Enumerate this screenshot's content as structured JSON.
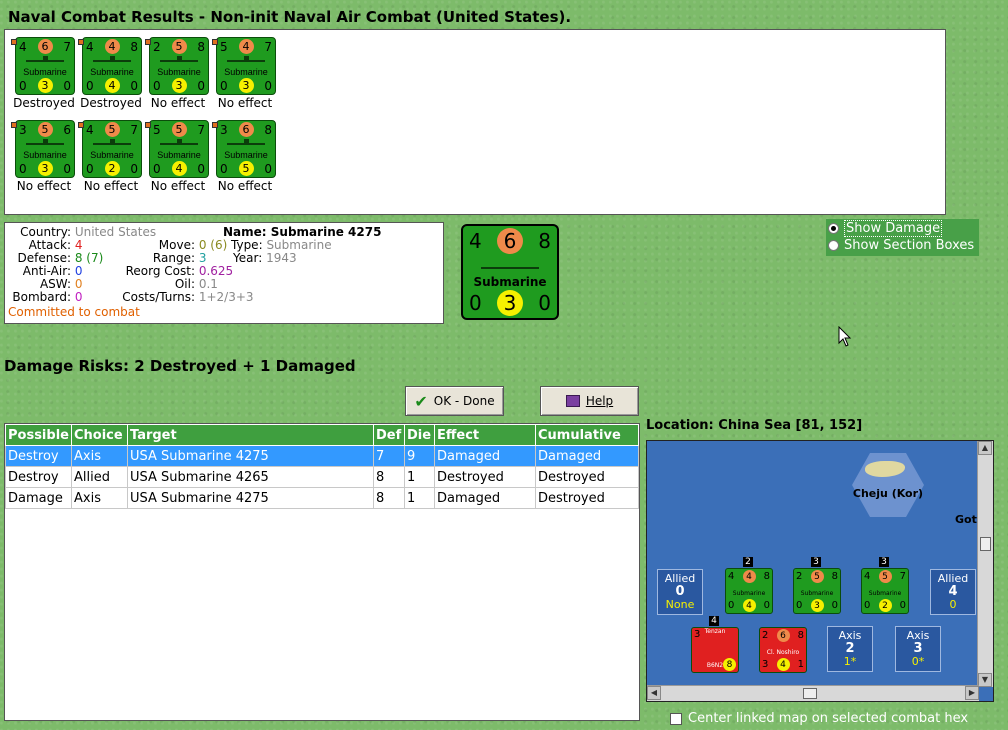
{
  "title": "Naval Combat Results - Non-init Naval Air Combat (United States).",
  "results": [
    {
      "top": [
        "4",
        "6",
        "7"
      ],
      "name": "Submarine",
      "bottom": [
        "0",
        "3",
        "0"
      ],
      "label": "Destroyed"
    },
    {
      "top": [
        "4",
        "4",
        "8"
      ],
      "name": "Submarine",
      "bottom": [
        "0",
        "4",
        "0"
      ],
      "label": "Destroyed"
    },
    {
      "top": [
        "2",
        "5",
        "8"
      ],
      "name": "Submarine",
      "bottom": [
        "0",
        "3",
        "0"
      ],
      "label": "No effect"
    },
    {
      "top": [
        "5",
        "4",
        "7"
      ],
      "name": "Submarine",
      "bottom": [
        "0",
        "3",
        "0"
      ],
      "label": "No effect"
    },
    {
      "top": [
        "3",
        "5",
        "6"
      ],
      "name": "Submarine",
      "bottom": [
        "0",
        "3",
        "0"
      ],
      "label": "No effect"
    },
    {
      "top": [
        "4",
        "5",
        "7"
      ],
      "name": "Submarine",
      "bottom": [
        "0",
        "2",
        "0"
      ],
      "label": "No effect"
    },
    {
      "top": [
        "5",
        "5",
        "7"
      ],
      "name": "Submarine",
      "bottom": [
        "0",
        "4",
        "0"
      ],
      "label": "No effect"
    },
    {
      "top": [
        "3",
        "6",
        "8"
      ],
      "name": "Submarine",
      "bottom": [
        "0",
        "5",
        "0"
      ],
      "label": "No effect"
    }
  ],
  "info": {
    "country_label": "Country:",
    "country": "United States",
    "attack_label": "Attack:",
    "attack": "4",
    "defense_label": "Defense:",
    "defense": "8 (7)",
    "antiair_label": "Anti-Air:",
    "antiair": "0",
    "asw_label": "ASW:",
    "asw": "0",
    "bombard_label": "Bombard:",
    "bombard": "0",
    "name_label": "Name:",
    "name": "Submarine 4275",
    "move_label": "Move:",
    "move": "0 (6)",
    "type_label": "Type:",
    "type": "Submarine",
    "range_label": "Range:",
    "range": "3",
    "year_label": "Year:",
    "year": "1943",
    "reorg_label": "Reorg Cost:",
    "reorg": "0.625",
    "oil_label": "Oil:",
    "oil": "0.1",
    "costs_label": "Costs/Turns:",
    "costs": "1+2/3+3",
    "status": "Committed to combat"
  },
  "big_counter": {
    "top": [
      "4",
      "6",
      "8"
    ],
    "name": "Submarine",
    "bottom": [
      "0",
      "3",
      "0"
    ]
  },
  "options": {
    "show_damage": "Show Damage",
    "show_sections": "Show Section Boxes"
  },
  "risks": "Damage Risks:  2 Destroyed + 1 Damaged",
  "buttons": {
    "ok": "OK - Done",
    "help": "Help"
  },
  "table": {
    "headers": [
      "Possible",
      "Choice",
      "Target",
      "Def",
      "Die",
      "Effect",
      "Cumulative"
    ],
    "rows": [
      [
        "Destroy",
        "Axis",
        "USA Submarine 4275",
        "7",
        "9",
        "Damaged",
        "Damaged"
      ],
      [
        "Destroy",
        "Allied",
        "USA Submarine 4265",
        "8",
        "1",
        "Destroyed",
        "Destroyed"
      ],
      [
        "Damage",
        "Axis",
        "USA Submarine 4275",
        "8",
        "1",
        "Damaged",
        "Destroyed"
      ]
    ]
  },
  "location": "Location:  China Sea [81, 152]",
  "map": {
    "island": "Cheju (Kor)",
    "got": "Got",
    "allied_box": {
      "label": "Allied",
      "num": "0",
      "sub": "None"
    },
    "allied_box2": {
      "label": "Allied",
      "num": "4",
      "sub": "0"
    },
    "axis_box1": {
      "label": "Axis",
      "num": "2",
      "sub": "1*"
    },
    "axis_box2": {
      "label": "Axis",
      "num": "3",
      "sub": "0*"
    },
    "stacks": [
      {
        "badge": "2",
        "top": [
          "4",
          "4",
          "8"
        ],
        "name": "Submarine",
        "bottom": [
          "0",
          "4",
          "0"
        ]
      },
      {
        "badge": "3",
        "top": [
          "2",
          "5",
          "8"
        ],
        "name": "Submarine",
        "bottom": [
          "0",
          "3",
          "0"
        ]
      },
      {
        "badge": "3",
        "top": [
          "4",
          "5",
          "7"
        ],
        "name": "Submarine",
        "bottom": [
          "0",
          "2",
          "0"
        ]
      }
    ],
    "red_stacks": [
      {
        "badge": "4",
        "top": [
          "3",
          "",
          ""
        ],
        "name": "Tenzan",
        "bottom": [
          "",
          "",
          "8"
        ],
        "extra": "B6N2"
      },
      {
        "badge": "",
        "top": [
          "2",
          "6",
          "8"
        ],
        "name": "Cl. Noshiro",
        "bottom": [
          "3",
          "4",
          "1"
        ]
      }
    ]
  },
  "center_map": "Center linked map on selected combat hex"
}
